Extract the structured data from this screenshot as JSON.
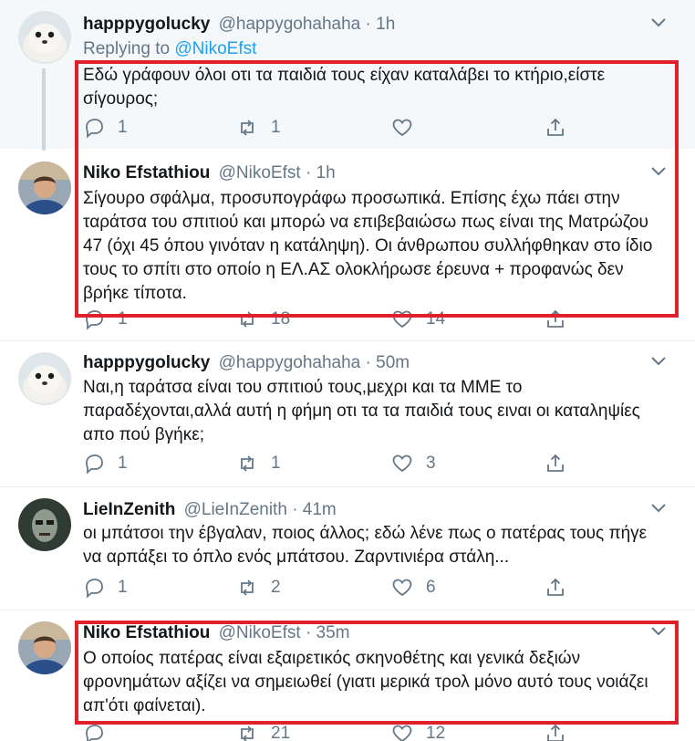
{
  "tweets": [
    {
      "name": "happpygolucky",
      "handle": "@happygohahaha",
      "dot": "·",
      "time": "1h",
      "replying_prefix": "Replying to ",
      "replying_mention": "@NikoEfst",
      "text": "Εδώ γράφουν όλοι οτι τα παιδιά τους είχαν καταλάβει το κτήριο,είστε σίγουρος;",
      "replies": "1",
      "retweets": "1",
      "likes": ""
    },
    {
      "name": "Niko Efstathiou",
      "handle": "@NikoEfst",
      "dot": "·",
      "time": "1h",
      "text": "Σίγουρο σφάλμα, προσυπογράφω προσωπικά. Επίσης έχω πάει στην ταράτσα του σπιτιού και μπορώ να επιβεβαιώσω πως είναι της Ματρώζου 47 (όχι 45 όπου γινόταν η κατάληψη). Οι άνθρωπου συλλήφθηκαν στο ίδιο τους το σπίτι στο οποίο η ΕΛ.ΑΣ ολοκλήρωσε έρευνα + προφανώς δεν βρήκε τίποτα.",
      "replies": "1",
      "retweets": "18",
      "likes": "14"
    },
    {
      "name": "happpygolucky",
      "handle": "@happygohahaha",
      "dot": "·",
      "time": "50m",
      "text": "Ναι,η ταράτσα είναι του σπιτιού τους,μεχρι και τα ΜΜΕ το παραδέχονται,αλλά αυτή η φήμη οτι τα τα παιδιά τους ειναι οι καταληψίες απο πού βγήκε;",
      "replies": "1",
      "retweets": "1",
      "likes": "3"
    },
    {
      "name": "LieInZenith",
      "handle": "@LieInZenith",
      "dot": "·",
      "time": "41m",
      "text": "οι μπάτσοι την έβγαλαν, ποιος άλλος; εδώ λένε πως ο πατέρας τους πήγε να αρπάξει το όπλο ενός μπάτσου. Ζαρντινιέρα στάλη...",
      "replies": "1",
      "retweets": "2",
      "likes": "6"
    },
    {
      "name": "Niko Efstathiou",
      "handle": "@NikoEfst",
      "dot": "·",
      "time": "35m",
      "text": "Ο οποίος πατέρας είναι εξαιρετικός σκηνοθέτης και γενικά δεξιών φρονημάτων αξίζει να σημειωθεί (γιατι μερικά τρολ μόνο αυτό τους νοιάζει απ'ότι φαίνεται).",
      "replies": "",
      "retweets": "21",
      "likes": "12"
    }
  ],
  "colors": {
    "highlight": "#e0202a",
    "link": "#1da1f2",
    "muted": "#657786",
    "thread_line": "#ccd6dd"
  },
  "icons": [
    "reply-icon",
    "retweet-icon",
    "like-icon",
    "share-icon",
    "caret-down-icon"
  ]
}
